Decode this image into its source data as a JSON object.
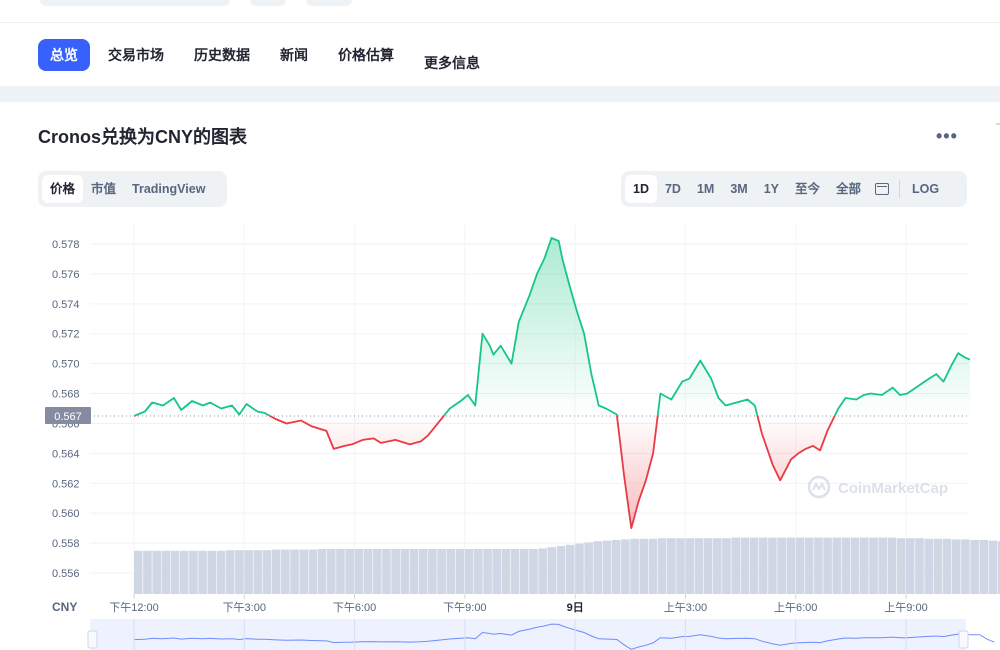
{
  "nav": {
    "tabs": [
      {
        "label": "总览",
        "active": true
      },
      {
        "label": "交易市场",
        "active": false
      },
      {
        "label": "历史数据",
        "active": false
      },
      {
        "label": "新闻",
        "active": false
      },
      {
        "label": "价格估算",
        "active": false
      },
      {
        "label": "更多信息",
        "active": false
      }
    ]
  },
  "chart_header": {
    "title": "Cronos兑换为CNY的图表",
    "more_icon": "more-horizontal-icon"
  },
  "view_toggle": {
    "options": [
      "价格",
      "市值",
      "TradingView"
    ],
    "selected": "价格"
  },
  "range_toggle": {
    "options": [
      "1D",
      "7D",
      "1M",
      "3M",
      "1Y",
      "至今",
      "全部"
    ],
    "selected": "1D",
    "calendar_icon": "calendar-icon",
    "log_label": "LOG"
  },
  "watermark": "CoinMarketCap",
  "colors": {
    "accent": "#3861fb",
    "up": "#16c784",
    "down": "#ea3943",
    "volume": "#cfd6e4",
    "current_price_tag": "#858ca2"
  },
  "chart_data": {
    "type": "line",
    "title": "Cronos兑换为CNY的图表",
    "currency_label": "CNY",
    "ylim": [
      0.555,
      0.5795
    ],
    "y_ticks": [
      "0.578",
      "0.576",
      "0.574",
      "0.572",
      "0.570",
      "0.568",
      "0.566",
      "0.564",
      "0.562",
      "0.560",
      "0.558",
      "0.556"
    ],
    "x_ticks": [
      "下午12:00",
      "下午3:00",
      "下午6:00",
      "下午9:00",
      "9日",
      "上午3:00",
      "上午6:00",
      "上午9:00"
    ],
    "x_tick_hours": [
      1,
      4,
      7,
      10,
      13,
      16,
      19,
      22
    ],
    "x_range_hours": [
      1,
      24.7
    ],
    "reference_price": 0.5665,
    "current_price_label": "0.567",
    "series": [
      {
        "x": [
          0.0,
          0.3,
          0.5,
          0.8,
          1.1,
          1.3,
          1.6,
          1.9,
          2.1,
          2.4,
          2.7,
          2.9,
          3.1,
          3.4,
          3.6,
          3.9,
          4.2,
          4.6,
          4.9,
          5.3,
          5.5,
          5.8,
          6.0,
          6.3,
          6.6,
          6.8,
          7.2,
          7.6,
          7.9,
          8.1,
          8.3,
          8.7,
          9.0,
          9.2,
          9.4,
          9.6,
          9.8,
          9.9,
          10.1,
          10.4,
          10.6,
          10.9,
          11.1,
          11.3,
          11.5,
          11.7,
          11.8,
          12.0,
          12.2,
          12.4,
          12.6,
          12.8,
          13.0,
          13.3,
          13.5,
          13.7,
          13.9,
          14.1,
          14.3,
          14.5,
          14.8,
          15.1,
          15.3,
          15.6,
          15.9,
          16.1,
          16.3,
          16.6,
          16.9,
          17.1,
          17.3,
          17.6,
          17.8,
          18.1,
          18.3,
          18.5,
          18.7,
          18.9,
          19.1,
          19.4,
          19.6,
          19.9,
          20.1,
          20.3,
          20.6,
          20.9,
          21.1,
          21.3,
          21.6,
          21.9,
          22.1,
          22.3,
          22.5,
          22.7,
          22.9,
          23.1,
          23.3,
          23.5,
          23.7
        ],
        "y": [
          0.5665,
          0.5668,
          0.5674,
          0.5672,
          0.5677,
          0.5669,
          0.5675,
          0.5672,
          0.5674,
          0.567,
          0.5672,
          0.5666,
          0.5673,
          0.5668,
          0.5667,
          0.5663,
          0.566,
          0.5662,
          0.5658,
          0.5655,
          0.5643,
          0.5645,
          0.5646,
          0.5649,
          0.565,
          0.5647,
          0.5649,
          0.5646,
          0.5648,
          0.5652,
          0.5658,
          0.567,
          0.5675,
          0.5679,
          0.5672,
          0.572,
          0.5712,
          0.5706,
          0.5712,
          0.57,
          0.5728,
          0.5746,
          0.576,
          0.577,
          0.5784,
          0.5782,
          0.577,
          0.5752,
          0.5735,
          0.572,
          0.5693,
          0.5672,
          0.567,
          0.5666,
          0.5625,
          0.559,
          0.5608,
          0.5622,
          0.564,
          0.568,
          0.5676,
          0.5688,
          0.569,
          0.5702,
          0.569,
          0.5677,
          0.5672,
          0.5674,
          0.5676,
          0.5672,
          0.5653,
          0.5632,
          0.5622,
          0.5636,
          0.564,
          0.5643,
          0.5645,
          0.5642,
          0.5655,
          0.567,
          0.5677,
          0.5676,
          0.5679,
          0.568,
          0.5679,
          0.5684,
          0.5679,
          0.568,
          0.5685,
          0.569,
          0.5693,
          0.5688,
          0.5698,
          0.5707,
          0.5704,
          0.5702,
          0.5703,
          0.5668,
          0.5645
        ]
      }
    ],
    "volume": {
      "x_start": 1.0,
      "x_step": 0.25,
      "values": [
        0.72,
        0.72,
        0.72,
        0.72,
        0.72,
        0.72,
        0.72,
        0.72,
        0.72,
        0.72,
        0.73,
        0.73,
        0.73,
        0.73,
        0.73,
        0.74,
        0.74,
        0.74,
        0.74,
        0.74,
        0.75,
        0.75,
        0.75,
        0.75,
        0.75,
        0.75,
        0.75,
        0.75,
        0.75,
        0.75,
        0.75,
        0.75,
        0.75,
        0.75,
        0.75,
        0.75,
        0.75,
        0.75,
        0.75,
        0.75,
        0.75,
        0.75,
        0.75,
        0.75,
        0.76,
        0.78,
        0.8,
        0.82,
        0.84,
        0.86,
        0.88,
        0.89,
        0.9,
        0.91,
        0.92,
        0.92,
        0.92,
        0.93,
        0.93,
        0.93,
        0.93,
        0.93,
        0.93,
        0.93,
        0.93,
        0.94,
        0.94,
        0.94,
        0.94,
        0.94,
        0.94,
        0.94,
        0.94,
        0.94,
        0.94,
        0.94,
        0.94,
        0.94,
        0.94,
        0.94,
        0.94,
        0.94,
        0.94,
        0.93,
        0.93,
        0.93,
        0.92,
        0.92,
        0.92,
        0.91,
        0.91,
        0.9,
        0.9,
        0.89,
        0.88,
        0.87,
        0.87,
        0.86
      ]
    },
    "grid": true,
    "legend": "none"
  }
}
